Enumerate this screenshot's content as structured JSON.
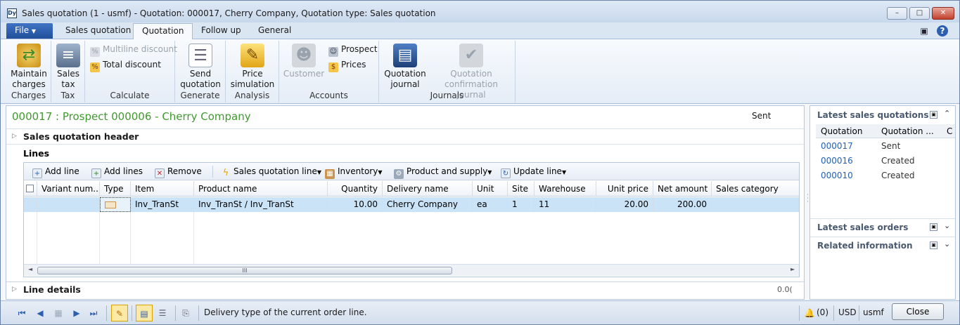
{
  "window": {
    "title": "Sales quotation (1 - usmf) - Quotation: 000017, Cherry Company, Quotation type: Sales quotation",
    "icon_label": "Dy",
    "controls": {
      "minimize": "–",
      "maximize": "□",
      "close": "✕"
    }
  },
  "tabs": [
    {
      "label": "File"
    },
    {
      "label": "Sales quotation"
    },
    {
      "label": "Quotation"
    },
    {
      "label": "Follow up"
    },
    {
      "label": "General"
    }
  ],
  "ribbon": {
    "charges": {
      "group": "Charges",
      "maintain_charges": "Maintain charges"
    },
    "tax": {
      "group": "Tax",
      "sales_tax": "Sales tax"
    },
    "calculate": {
      "group": "Calculate",
      "multiline_discount": "Multiline discount",
      "total_discount": "Total discount"
    },
    "generate": {
      "group": "Generate",
      "send_quotation": "Send quotation"
    },
    "analysis": {
      "group": "Analysis",
      "price_simulation": "Price simulation"
    },
    "accounts": {
      "group": "Accounts",
      "customer": "Customer",
      "prospect": "Prospect",
      "prices": "Prices"
    },
    "journals": {
      "group": "Journals",
      "quotation_journal": "Quotation journal",
      "confirmation_journal": "Quotation confirmation journal"
    }
  },
  "record": {
    "title": "000017 : Prospect 000006 - Cherry Company",
    "status": "Sent"
  },
  "sections": {
    "header": "Sales quotation header",
    "lines": "Lines",
    "line_details": "Line details",
    "line_details_value": "0.0("
  },
  "lines_toolbar": {
    "add_line": "Add line",
    "add_lines": "Add lines",
    "remove": "Remove",
    "sales_quotation_line": "Sales quotation line",
    "inventory": "Inventory",
    "product_and_supply": "Product and supply",
    "update_line": "Update line"
  },
  "grid": {
    "columns": [
      "Variant num...",
      "Type",
      "Item",
      "Product name",
      "Quantity",
      "Delivery name",
      "Unit",
      "Site",
      "Warehouse",
      "Unit price",
      "Net amount",
      "Sales category"
    ],
    "rows": [
      {
        "variant": "",
        "type": "",
        "item": "Inv_TranSt",
        "product_name": "Inv_TranSt / Inv_TranSt",
        "quantity": "10.00",
        "delivery_name": "Cherry Company",
        "unit": "ea",
        "site": "1",
        "warehouse": "11",
        "unit_price": "20.00",
        "net_amount": "200.00",
        "sales_category": ""
      }
    ],
    "scroll_thumb": "III"
  },
  "factbox": {
    "latest_quotations": {
      "title": "Latest sales quotations",
      "col_quotation": "Quotation",
      "col_status": "Quotation ...",
      "col_extra": "C",
      "rows": [
        {
          "id": "000017",
          "status": "Sent"
        },
        {
          "id": "000016",
          "status": "Created"
        },
        {
          "id": "000010",
          "status": "Created"
        }
      ]
    },
    "latest_orders": {
      "title": "Latest sales orders"
    },
    "related_info": {
      "title": "Related information"
    }
  },
  "statusbar": {
    "message": "Delivery type of the current order line.",
    "notifications": "(0)",
    "currency": "USD",
    "company": "usmf",
    "close": "Close"
  }
}
